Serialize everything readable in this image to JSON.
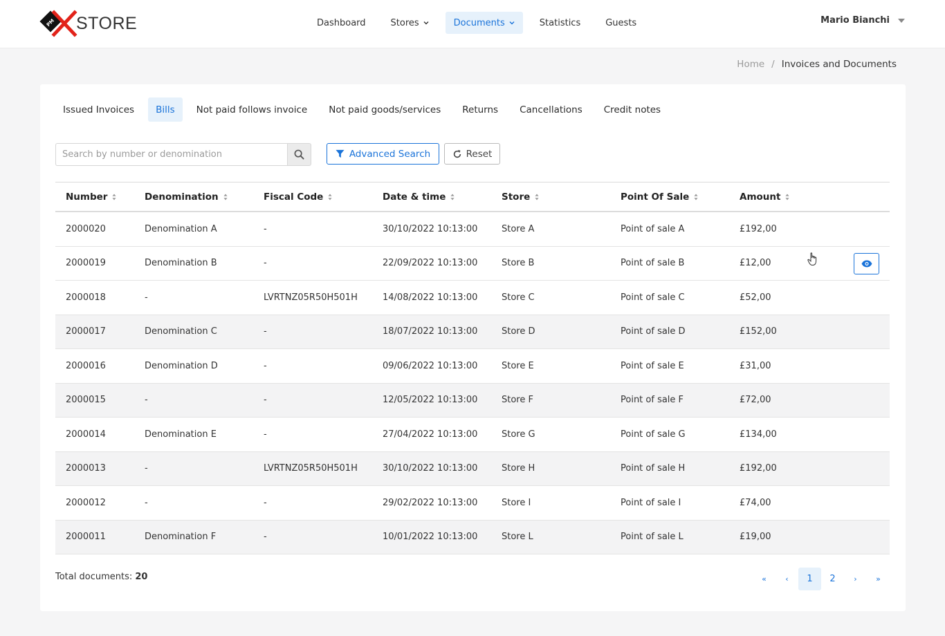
{
  "brand": {
    "name": "STORE",
    "badge": "PM"
  },
  "nav": {
    "items": [
      {
        "label": "Dashboard",
        "dropdown": false,
        "active": false
      },
      {
        "label": "Stores",
        "dropdown": true,
        "active": false
      },
      {
        "label": "Documents",
        "dropdown": true,
        "active": true
      },
      {
        "label": "Statistics",
        "dropdown": false,
        "active": false
      },
      {
        "label": "Guests",
        "dropdown": false,
        "active": false
      }
    ]
  },
  "user": {
    "name": "Mario Bianchi"
  },
  "breadcrumb": {
    "home": "Home",
    "separator": "/",
    "current": "Invoices and Documents"
  },
  "tabs": [
    {
      "label": "Issued Invoices",
      "active": false
    },
    {
      "label": "Bills",
      "active": true
    },
    {
      "label": "Not paid follows invoice",
      "active": false
    },
    {
      "label": "Not paid goods/services",
      "active": false
    },
    {
      "label": "Returns",
      "active": false
    },
    {
      "label": "Cancellations",
      "active": false
    },
    {
      "label": "Credit notes",
      "active": false
    }
  ],
  "search": {
    "placeholder": "Search by number or denomination",
    "value": ""
  },
  "buttons": {
    "advanced_search": "Advanced Search",
    "reset": "Reset"
  },
  "table": {
    "columns": [
      "Number",
      "Denomination",
      "Fiscal Code",
      "Date & time",
      "Store",
      "Point Of Sale",
      "Amount"
    ],
    "rows": [
      {
        "number": "2000020",
        "denomination": "Denomination A",
        "fiscal_code": "-",
        "date": "30/10/2022 10:13:00",
        "store": "Store A",
        "pos": "Point of sale A",
        "amount": "£192,00"
      },
      {
        "number": "2000019",
        "denomination": "Denomination B",
        "fiscal_code": "-",
        "date": "22/09/2022 10:13:00",
        "store": "Store B",
        "pos": "Point of sale B",
        "amount": "£12,00"
      },
      {
        "number": "2000018",
        "denomination": "-",
        "fiscal_code": "LVRTNZ05R50H501H",
        "date": "14/08/2022 10:13:00",
        "store": "Store C",
        "pos": "Point of sale C",
        "amount": "£52,00"
      },
      {
        "number": "2000017",
        "denomination": "Denomination C",
        "fiscal_code": "-",
        "date": "18/07/2022 10:13:00",
        "store": "Store D",
        "pos": "Point of sale D",
        "amount": "£152,00"
      },
      {
        "number": "2000016",
        "denomination": "Denomination D",
        "fiscal_code": "-",
        "date": "09/06/2022 10:13:00",
        "store": "Store E",
        "pos": "Point of sale E",
        "amount": "£31,00"
      },
      {
        "number": "2000015",
        "denomination": "-",
        "fiscal_code": "-",
        "date": "12/05/2022 10:13:00",
        "store": "Store F",
        "pos": "Point of sale F",
        "amount": "£72,00"
      },
      {
        "number": "2000014",
        "denomination": "Denomination E",
        "fiscal_code": "-",
        "date": "27/04/2022 10:13:00",
        "store": "Store G",
        "pos": "Point of sale G",
        "amount": "£134,00"
      },
      {
        "number": "2000013",
        "denomination": "-",
        "fiscal_code": "LVRTNZ05R50H501H",
        "date": "30/10/2022 10:13:00",
        "store": "Store H",
        "pos": "Point of sale H",
        "amount": "£192,00"
      },
      {
        "number": "2000012",
        "denomination": "-",
        "fiscal_code": "-",
        "date": "29/02/2022 10:13:00",
        "store": "Store I",
        "pos": "Point of sale I",
        "amount": "£74,00"
      },
      {
        "number": "2000011",
        "denomination": "Denomination F",
        "fiscal_code": "-",
        "date": "10/01/2022 10:13:00",
        "store": "Store L",
        "pos": "Point of sale L",
        "amount": "£19,00"
      }
    ],
    "hovered_row": 1,
    "row_action_icon": "eye-icon"
  },
  "footer": {
    "total_label": "Total documents:",
    "total_value": "20",
    "pagination": {
      "first": "«",
      "prev": "‹",
      "pages": [
        "1",
        "2"
      ],
      "current": "1",
      "next": "›",
      "last": "»"
    }
  },
  "colors": {
    "accent": "#1a73d9",
    "accent_bg": "#e6f1fb",
    "logo_red": "#e2231a"
  }
}
